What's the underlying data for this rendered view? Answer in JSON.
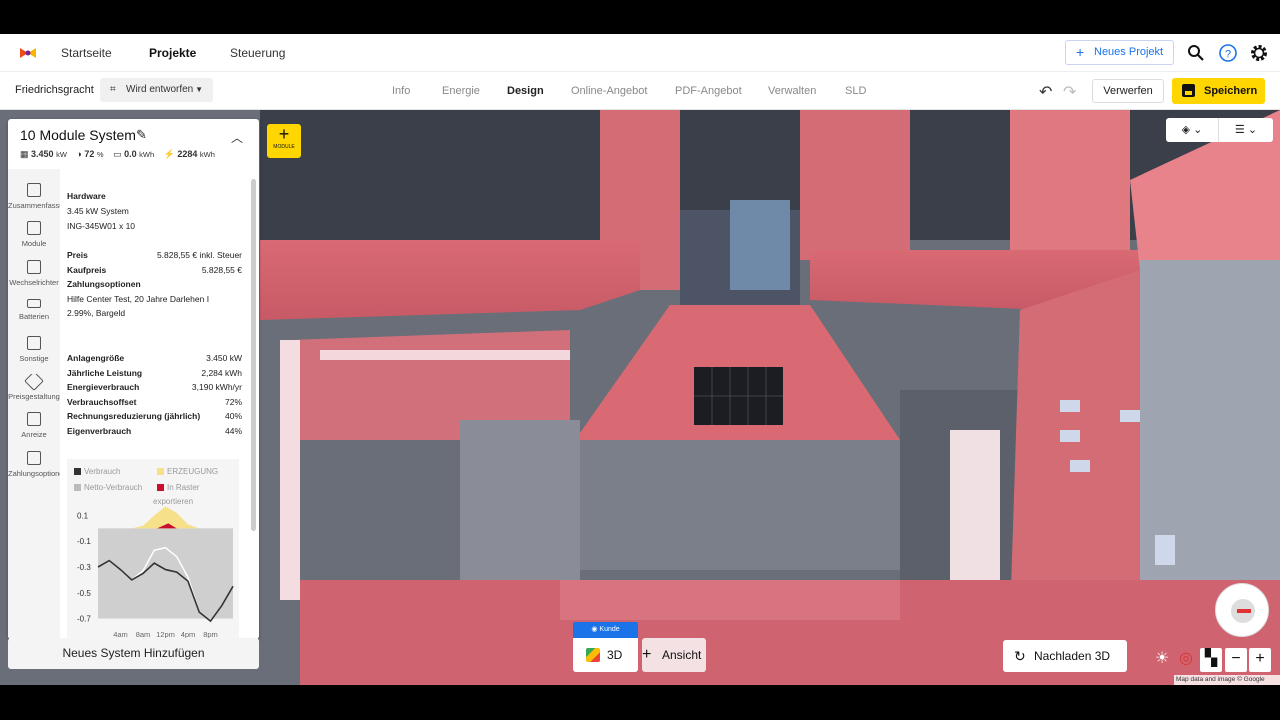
{
  "topnav": {
    "links": [
      "Startseite",
      "Projekte",
      "Steuerung"
    ],
    "new_project_label": "Neues Projekt"
  },
  "subnav": {
    "project_name": "Friedrichsgracht",
    "status": "Wird entworfen",
    "tabs": [
      "Info",
      "Energie",
      "Design",
      "Online-Angebot",
      "PDF-Angebot",
      "Verwalten",
      "SLD"
    ],
    "active_tab": "Design",
    "discard_label": "Verwerfen",
    "save_label": "Speichern"
  },
  "panel": {
    "title": "10 Module System",
    "stats": {
      "power": "3.450",
      "power_unit": "kW",
      "offset": "72",
      "offset_unit": "%",
      "battery": "0.0",
      "battery_unit": "kWh",
      "production": "2284",
      "production_unit": "kWh"
    },
    "sidebar": [
      {
        "label": "Zusammenfassung",
        "icon": "document-icon"
      },
      {
        "label": "Module",
        "icon": "grid-icon"
      },
      {
        "label": "Wechselrichter",
        "icon": "inverter-icon"
      },
      {
        "label": "Batterien",
        "icon": "battery-icon"
      },
      {
        "label": "Sonstige",
        "icon": "apps-icon"
      },
      {
        "label": "Preisgestaltung",
        "icon": "tag-icon"
      },
      {
        "label": "Anreize",
        "icon": "gift-icon"
      },
      {
        "label": "Zahlungsoptionen",
        "icon": "wallet-icon"
      }
    ],
    "hardware_heading": "Hardware",
    "hardware_system": "3.45 kW System",
    "hardware_module": "ING-345W01 x 10",
    "price_label": "Preis",
    "price_value": "5.828,55 € inkl. Steuer",
    "purchase_label": "Kaufpreis",
    "purchase_value": "5.828,55 €",
    "payment_label": "Zahlungsoptionen",
    "payment_line1": "Hilfe Center Test, 20 Jahre Darlehen I",
    "payment_line2": "2.99%, Bargeld",
    "metrics": [
      {
        "label": "Anlagengröße",
        "value": "3.450 kW"
      },
      {
        "label": "Jährliche Leistung",
        "value": "2,284 kWh"
      },
      {
        "label": "Energieverbrauch",
        "value": "3,190 kWh/yr"
      },
      {
        "label": "Verbrauchsoffset",
        "value": "72%"
      },
      {
        "label": "Rechnungsreduzierung (jährlich)",
        "value": "40%"
      },
      {
        "label": "Eigenverbrauch",
        "value": "44%"
      }
    ],
    "add_system_label": "Neues System Hinzufügen"
  },
  "chart_data": {
    "type": "area",
    "title": "",
    "legend": [
      {
        "name": "Verbrauch",
        "color": "#333333"
      },
      {
        "name": "ERZEUGUNG",
        "color": "#f6e08a"
      },
      {
        "name": "Netto-Verbrauch",
        "color": "#bbbbbb"
      },
      {
        "name": "In Raster exportieren",
        "color": "#c8102e"
      }
    ],
    "legend_line1": {
      "a": "Verbrauch",
      "b": "ERZEUGUNG"
    },
    "legend_line2": {
      "a": "Netto-Verbrauch",
      "b": "In Raster"
    },
    "legend_line3": "exportieren",
    "x_ticks": [
      "4am",
      "8am",
      "12pm",
      "4pm",
      "8pm"
    ],
    "y_ticks": [
      "0.1",
      "-0.1",
      "-0.3",
      "-0.5",
      "-0.7"
    ],
    "ylim": [
      -0.75,
      0.15
    ],
    "x": [
      0,
      2,
      4,
      6,
      8,
      10,
      12,
      14,
      16,
      18,
      20,
      22,
      24
    ],
    "series": [
      {
        "name": "ERZEUGUNG",
        "values": [
          0,
          0,
          0,
          0,
          0.02,
          0.1,
          0.17,
          0.12,
          0.03,
          0,
          0,
          0,
          0
        ]
      },
      {
        "name": "Netto-Verbrauch",
        "values": [
          -0.3,
          -0.25,
          -0.32,
          -0.4,
          -0.33,
          -0.17,
          -0.15,
          -0.22,
          -0.38,
          -0.65,
          -0.72,
          -0.6,
          -0.45
        ]
      },
      {
        "name": "Verbrauch",
        "values": [
          -0.3,
          -0.25,
          -0.32,
          -0.4,
          -0.35,
          -0.27,
          -0.32,
          -0.34,
          -0.41,
          -0.65,
          -0.72,
          -0.6,
          -0.45
        ]
      }
    ]
  },
  "map": {
    "module_button_label": "MODULE",
    "customer_view_label": "Kunde",
    "view3d_label": "3D",
    "add_view_label": "Ansicht",
    "reload_label": "Nachladen 3D",
    "attribution": "Map data and image © Google"
  }
}
